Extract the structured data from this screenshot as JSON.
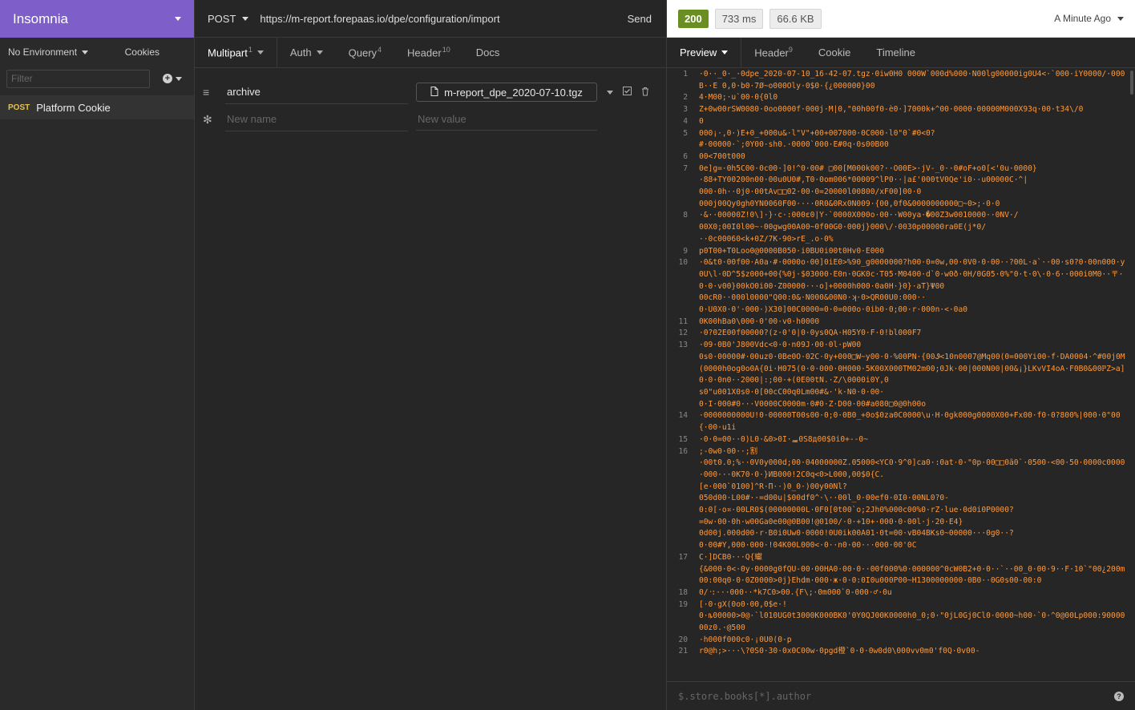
{
  "app": {
    "name": "Insomnia"
  },
  "sidebar": {
    "environment": "No Environment",
    "cookies_label": "Cookies",
    "filter_placeholder": "Filter",
    "requests": [
      {
        "method": "POST",
        "name": "Platform Cookie"
      }
    ]
  },
  "request": {
    "method": "POST",
    "url": "https://m-report.forepaas.io/dpe/configuration/import",
    "send_label": "Send",
    "tabs": [
      {
        "label": "Multipart",
        "count": "1"
      },
      {
        "label": "Auth",
        "count": ""
      },
      {
        "label": "Query",
        "count": "4"
      },
      {
        "label": "Header",
        "count": "10"
      },
      {
        "label": "Docs",
        "count": ""
      }
    ],
    "params": [
      {
        "name": "archive",
        "file": "m-report_dpe_2020-07-10.tgz"
      }
    ],
    "new_name_placeholder": "New name",
    "new_value_placeholder": "New value"
  },
  "response": {
    "status": "200",
    "time": "733 ms",
    "size": "66.6 KB",
    "time_ago": "A Minute Ago",
    "tabs": [
      {
        "label": "Preview",
        "count": ""
      },
      {
        "label": "Header",
        "count": "9"
      },
      {
        "label": "Cookie",
        "count": ""
      },
      {
        "label": "Timeline",
        "count": ""
      }
    ],
    "filter_query": "$.store.books[*].author",
    "lines": [
      {
        "n": "1",
        "t": "·0··_0·_·0dpe_2020-07-10_16-42-07.tgz·0iw0H0 000W`000d%000·N00lg00000ig0U4<·`000·iY0000/·000B··E 0,0·b0·7Ø~o000Oly·0$0·{¿000000}00"
      },
      {
        "n": "2",
        "t": "4·M00;·u`00·0{0l0"
      },
      {
        "n": "3",
        "t": "Z+0w00rSW0080·0oo0000f·000j·M|0,\"00h00f0-è0·]7000k+^00·0000·00000M000X93q·00·t34\\/0"
      },
      {
        "n": "4",
        "t": "0"
      },
      {
        "n": "5",
        "t": "000¡·,0·)E+0_+000u&·l\"V\"+00+007000·0C000·l0\"0`#0<0?\n#·00000·`;0Y00·sh0.·0000`000·E#0q·0s00B00"
      },
      {
        "n": "6",
        "t": "00<700t000"
      },
      {
        "n": "7",
        "t": "0e]g=·0h5C00·0c00·]0!^0·00# □00[M000k00?··O00E>·jV-_0··0#oF+o0[<'0u·0000}\n·88+TY00200n00·00u0U0#,T0·0om006*00009^lP0··|a£'000tV0Qe'i0··u00000C·^|\n000·0h··0j0·00tAv□□02·00·0=20000l00800/xF00]00·0\n000j00Qy0gh0YN0060F00····0R0&0Rx0N009·{00,0f0&0000000000□~0>;·0·0"
      },
      {
        "n": "8",
        "t": "·&··00000Z!0\\]·}·c·:000ε0|Y·`0000X000o·00··W00ya·�00Z3w0010000··0NV·/\n00X0;00I0l00~·00gwg00A00~0f00G0·000j}000\\/·0030p00000ra0E(j*0/\n··0c00060<k+0Z/7K·90>rE_.o·0%"
      },
      {
        "n": "9",
        "t": "p0T00+T0Loo0@0000B050·i0BU0i00t0Hv0·E000"
      },
      {
        "n": "10",
        "t": "·0&t0·00f00·A0a·#·0000o·00]0iE0>%90_g0000000?h00·0=0w,00·0V0·0·00··?00L·a`··00·s0?0·00n000·y0U\\l·0D^5$z000+00{%0j·$03000·E0n·0GK0c·T05·M0400·d`0·w0ð·0H/0G05·0%\"0·t·0\\·0·6··000i0M0··〒·0·0·v00}00kO0i00·Z00000···o]+0000h000·0a0H·}0}·aT}Ψ00\n00cR0··000l0000\"Q00:0&·N000&00N0·ʞ·0>QR00U0:000··\n0·U0X0·0'·000·)X30]00C0000=0·0=000o·0ib0·0;00·r·000n·<·0a0"
      },
      {
        "n": "11",
        "t": "0K00hBa0\\000·0'00·v0·h0000"
      },
      {
        "n": "12",
        "t": "·0?02E00f00000?(z·0'0|0·0ys0QA·H05Y0·F·0!bl000F7"
      },
      {
        "n": "13",
        "t": "·09·0B0'J800Vdc<0·0·n09J·00·0l·pW00\n0s0·00000#·00uz0·0Be0O·02C·0y+000□W~y00·0·%00PN·{00Ꮽ<10n0007@Mq00(0=000Yi00-f·DA0004·^#00j0M(0000h0og0o0A{0i·H075(0·0·000·0H000·5K00X000TM02m00;0Jk·00|000N00|00&¡}LKvVI4oA·F0B0&00ℙZ>a]0·0·0n0··2000|:;00·+(0E00tN.·Z/\\0000i0Y,0\ns0\"u001X0s0·0[00cC00q0Lm00#&·'k·N0·0·00·\n0·I·000#0···V0000C0000m·0#0·Z·D00·00#a080□0@0h00o"
      },
      {
        "n": "14",
        "t": "·0000000000U!0·00000T00s00·0;0·0B0_+0o$0za0C0000\\u·H·0gk000g0000X00+Fx00·f0·0?800%|000·0\"00{·00·u1i"
      },
      {
        "n": "15",
        "t": "·0·0=00··0)L0·&0>0I·ퟚ0S8д00$0i0+--0~"
      },
      {
        "n": "16",
        "t": ";-0w0·00··;割\n·00t0.0;%··0V0y000d;00·04000000Z.05000<YC0·9^0]ca0·:0at·0·\"0p·00□□0ã0`·0500·<00·50·0000c0000·000···0K70·0·}ИB000!2C0q<0>L000,00$0{C.\n[e·000`0100]^R·П··)0_0·)00y00Nl?\n050d00·L00#··=d00u|$00df0^·\\··00l_0·00ef0·0I0·00NL0?0-\n0:0[·o¤·00LR0$(00000000L·0F0[0t00`o;2Jh0%000c00%0·rZ·lue·0d0i0P0000?\n=0w·00·0h·w00Ga0e00@0B00!@0100/·0·+10+·000·0·00l·j·20·E4}\n0d00j.000d00·r·B0i0Uw0·0000!0U0ik00A01·0t=00·vB04BKs0~00000···0g0··?\n0·00#Y,000·000·!04K00L000<·0··n0·00···000·00'0C"
      },
      {
        "n": "17",
        "t": "C·]DCB0···Q{瓛\n{&000·0<·0y·0000g0fQU-00·00HA0·00·0··00f000%0·000000^0cW0B2+0·0··`··00_0·00·9··F·10`\"00¿200m00:00q0·0·0Z0000>0j}Ehdm·000·ж·0·0:0I0u000P00~H1300000000·0B0··0G0s00-00:0"
      },
      {
        "n": "18",
        "t": "0/᠂:···000··*k7C0>00.{F\\;·0m000`0-000·♂·0u"
      },
      {
        "n": "19",
        "t": "[·0·gX(0o0·00,0$e·!\n0·ȵ00000>0@·`l010UG0t3000K000BK0'0Y0QJ00K0000h0_0;0·\"0jL0Gj0Cl0·0000~h00·`0·^0@00Lp000:9000000z0.·@500"
      },
      {
        "n": "20",
        "t": "·h000f000c0·¡0U0(0·p"
      },
      {
        "n": "21",
        "t": "r0@h;>···\\?0S0·30·0x0C00w·0pgd橙`0·0·0w0d0\\000vv0m0'f0Q·0v00-"
      }
    ]
  }
}
